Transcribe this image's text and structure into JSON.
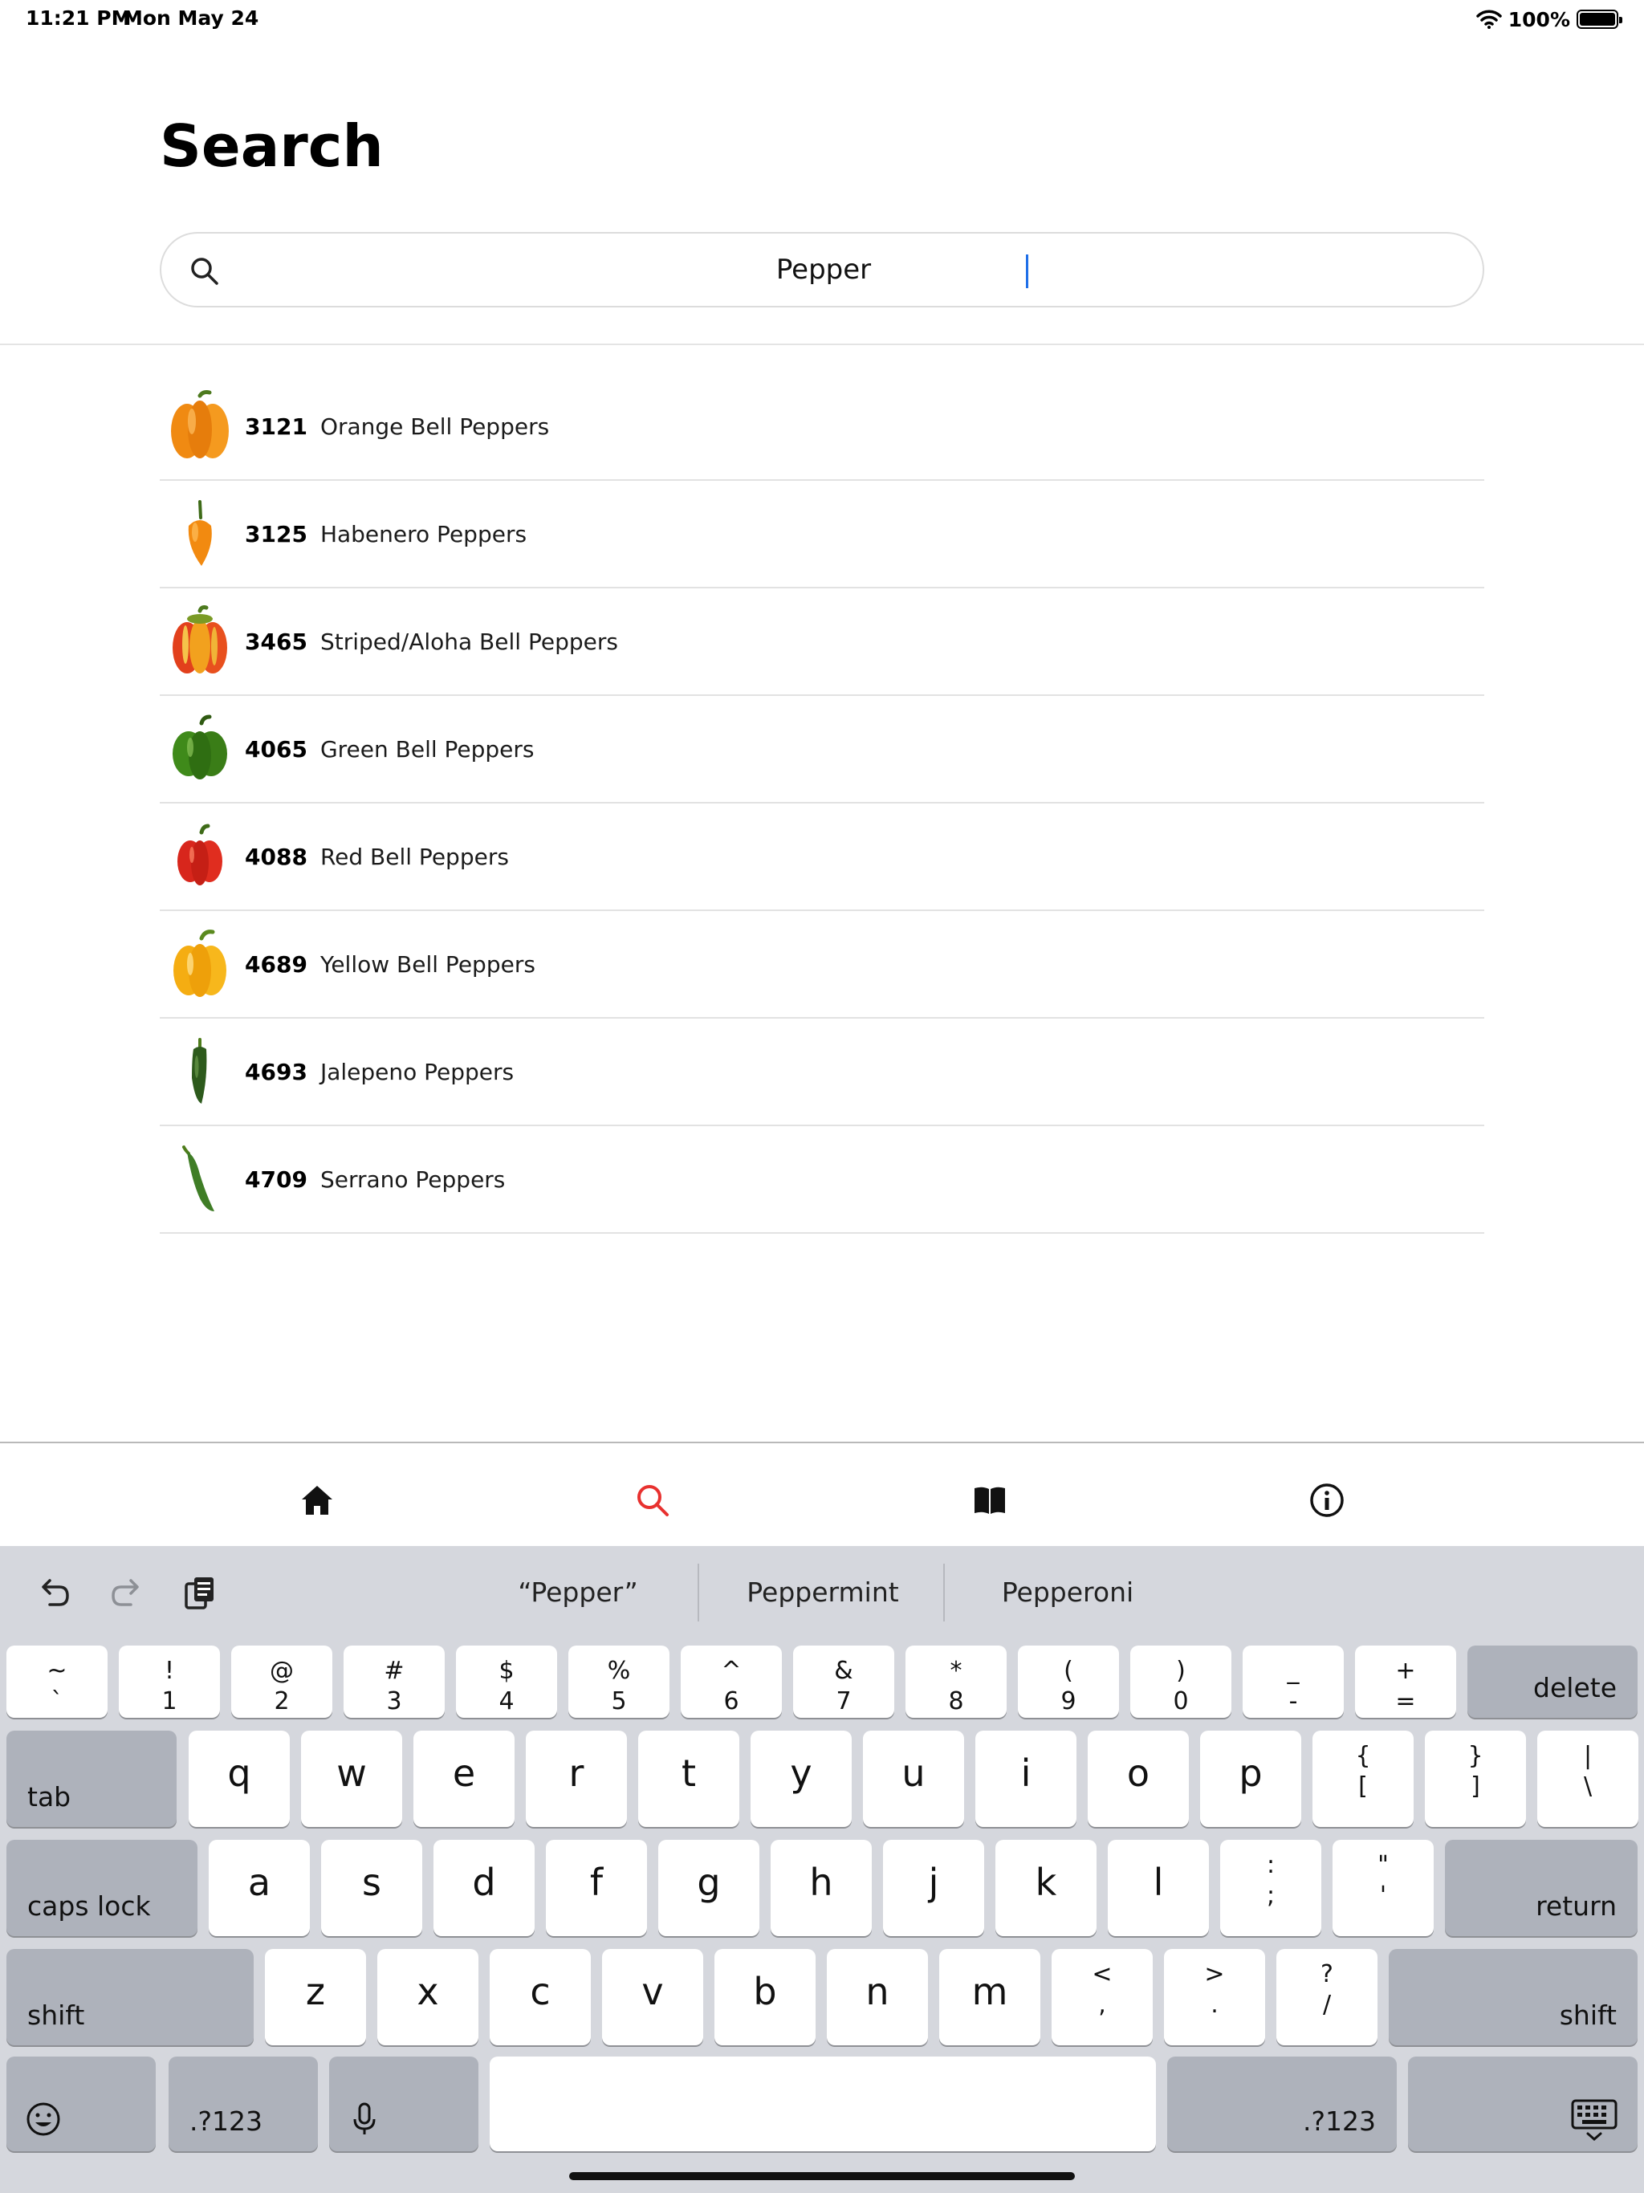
{
  "status_bar": {
    "time": "11:21 PM",
    "date": "Mon May 24",
    "battery": "100%"
  },
  "page": {
    "title": "Search"
  },
  "search": {
    "value": "Pepper"
  },
  "results": [
    {
      "plu": "3121",
      "name": "Orange Bell Peppers",
      "thumb": "orange-bell-pepper-image"
    },
    {
      "plu": "3125",
      "name": "Habenero Peppers",
      "thumb": "habanero-pepper-image"
    },
    {
      "plu": "3465",
      "name": "Striped/Aloha Bell Peppers",
      "thumb": "striped-bell-pepper-image"
    },
    {
      "plu": "4065",
      "name": "Green Bell Peppers",
      "thumb": "green-bell-pepper-image"
    },
    {
      "plu": "4088",
      "name": "Red Bell Peppers",
      "thumb": "red-bell-pepper-image"
    },
    {
      "plu": "4689",
      "name": "Yellow Bell Peppers",
      "thumb": "yellow-bell-pepper-image"
    },
    {
      "plu": "4693",
      "name": "Jalepeno Peppers",
      "thumb": "jalapeno-pepper-image"
    },
    {
      "plu": "4709",
      "name": "Serrano Peppers",
      "thumb": "serrano-pepper-image"
    }
  ],
  "tab_bar": {
    "tabs": [
      {
        "icon": "home-icon",
        "active": false
      },
      {
        "icon": "search-icon",
        "active": true
      },
      {
        "icon": "book-icon",
        "active": false
      },
      {
        "icon": "info-icon",
        "active": false
      }
    ],
    "active_color": "#e8312f"
  },
  "keyboard": {
    "suggestions": [
      "“Pepper”",
      "Peppermint",
      "Pepperoni"
    ],
    "number_row": [
      {
        "top": "~",
        "bottom": "`"
      },
      {
        "top": "!",
        "bottom": "1"
      },
      {
        "top": "@",
        "bottom": "2"
      },
      {
        "top": "#",
        "bottom": "3"
      },
      {
        "top": "$",
        "bottom": "4"
      },
      {
        "top": "%",
        "bottom": "5"
      },
      {
        "top": "^",
        "bottom": "6"
      },
      {
        "top": "&",
        "bottom": "7"
      },
      {
        "top": "*",
        "bottom": "8"
      },
      {
        "top": "(",
        "bottom": "9"
      },
      {
        "top": ")",
        "bottom": "0"
      },
      {
        "top": "_",
        "bottom": "-"
      },
      {
        "top": "+",
        "bottom": "="
      }
    ],
    "delete": "delete",
    "tab": "tab",
    "row_q": [
      "q",
      "w",
      "e",
      "r",
      "t",
      "y",
      "u",
      "i",
      "o",
      "p"
    ],
    "row_q_symbols": [
      {
        "top": "{",
        "bottom": "["
      },
      {
        "top": "}",
        "bottom": "]"
      },
      {
        "top": "|",
        "bottom": "\\"
      }
    ],
    "caps_lock": "caps lock",
    "row_a": [
      "a",
      "s",
      "d",
      "f",
      "g",
      "h",
      "j",
      "k",
      "l"
    ],
    "row_a_symbols": [
      {
        "top": ":",
        "bottom": ";"
      },
      {
        "top": "\"",
        "bottom": "'"
      }
    ],
    "return": "return",
    "shift": "shift",
    "row_z": [
      "z",
      "x",
      "c",
      "v",
      "b",
      "n",
      "m"
    ],
    "row_z_symbols": [
      {
        "top": "<",
        "bottom": ","
      },
      {
        "top": ">",
        "bottom": "."
      },
      {
        "top": "?",
        "bottom": "/"
      }
    ],
    "numbers_key": ".?123"
  },
  "colors": {
    "accent": "#e8312f",
    "caret": "#1f6fe8",
    "keyboard_bg": "#d5d7dd"
  }
}
